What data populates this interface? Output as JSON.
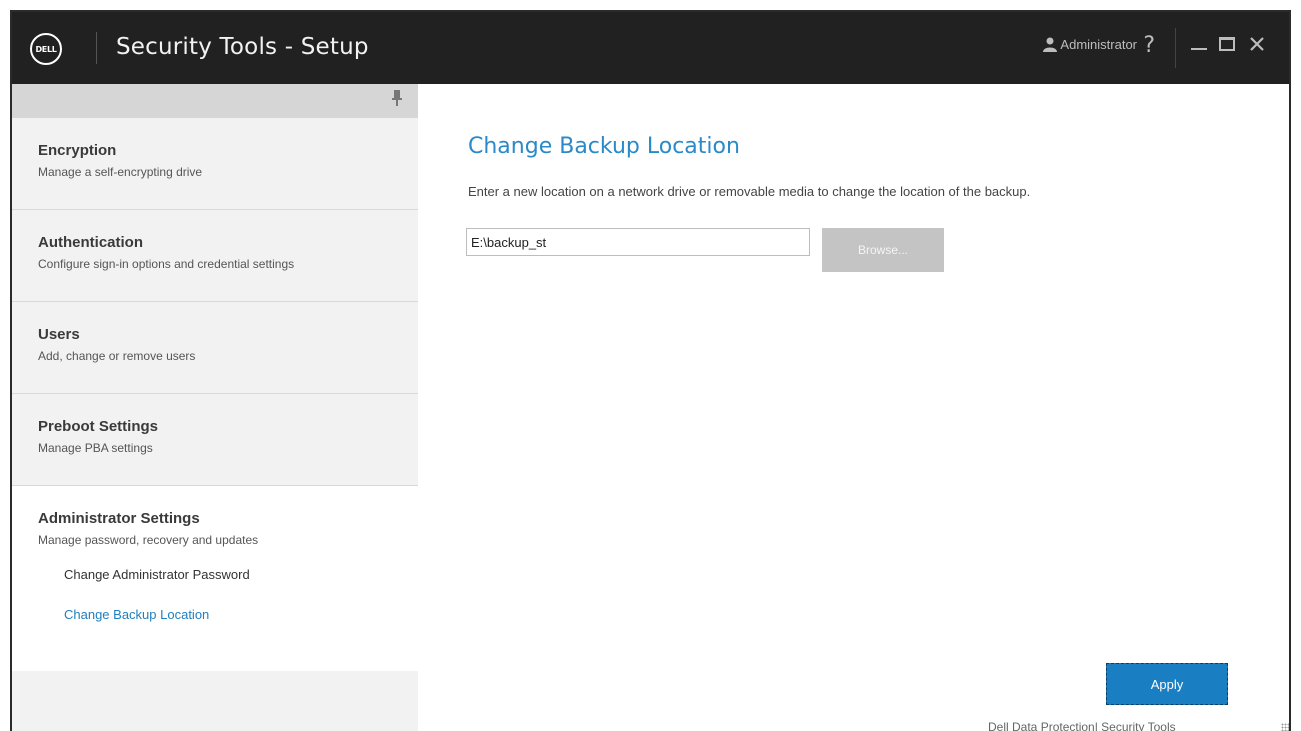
{
  "window": {
    "logo_text": "DELL",
    "title": "Security Tools - Setup",
    "user_label": "Administrator",
    "help_glyph": "?",
    "icons": [
      "user-icon",
      "help-icon",
      "minimize-icon",
      "maximize-icon",
      "close-icon",
      "pin-icon"
    ]
  },
  "sidebar": {
    "items": [
      {
        "title": "Encryption",
        "desc": "Manage a self-encrypting drive"
      },
      {
        "title": "Authentication",
        "desc": "Configure sign-in options and credential settings"
      },
      {
        "title": "Users",
        "desc": "Add, change or remove users"
      },
      {
        "title": "Preboot Settings",
        "desc": "Manage PBA settings"
      },
      {
        "title": "Administrator Settings",
        "desc": "Manage password, recovery and updates"
      }
    ],
    "subitems": [
      {
        "label": "Change Administrator Password"
      },
      {
        "label": "Change Backup Location",
        "selected": true
      }
    ]
  },
  "main": {
    "title": "Change Backup Location",
    "description": "Enter a new location on a network drive or removable media to change the location of the backup.",
    "path_value": "E:\\backup_st",
    "browse_label": "Browse...",
    "apply_label": "Apply",
    "footer": "Dell Data Protection| Security Tools"
  },
  "colors": {
    "titlebar": "#212121",
    "accent": "#1a7ec2",
    "link": "#1f7fbf",
    "sidebar_bg": "#f2f2f2"
  }
}
